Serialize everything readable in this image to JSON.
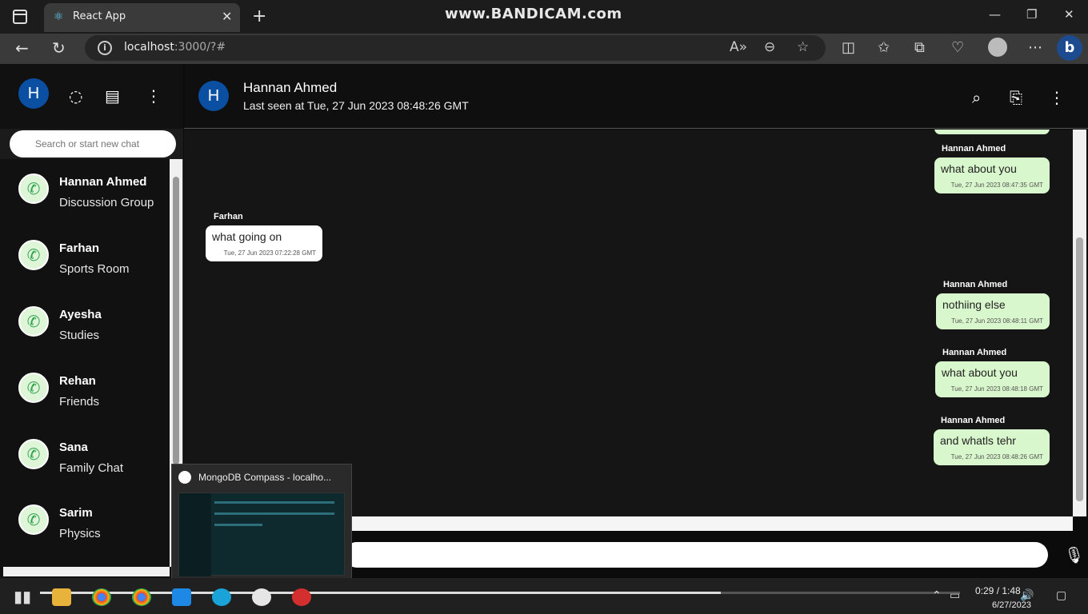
{
  "browser": {
    "tab_title": "React App",
    "url_host": "localhost",
    "url_path": ":3000/?#",
    "watermark": "www.BANDICAM.com"
  },
  "sidebar": {
    "user_initial": "H",
    "search_placeholder": "Search or start new chat",
    "chats": [
      {
        "name": "Hannan Ahmed",
        "subtitle": "Discussion Group"
      },
      {
        "name": "Farhan",
        "subtitle": "Sports Room"
      },
      {
        "name": "Ayesha",
        "subtitle": "Studies"
      },
      {
        "name": "Rehan",
        "subtitle": "Friends"
      },
      {
        "name": "Sana",
        "subtitle": "Family Chat"
      },
      {
        "name": "Sarim",
        "subtitle": "Physics"
      }
    ]
  },
  "chat": {
    "initial": "H",
    "name": "Hannan Ahmed",
    "last_seen": "Last seen at Tue, 27 Jun 2023 08:48:26 GMT",
    "messages": [
      {
        "author": "Hannan Ahmed",
        "text": "what about you",
        "time": "Tue, 27 Jun 2023 08:47:35 GMT",
        "direction": "out"
      },
      {
        "author": "Farhan",
        "text": "what going on",
        "time": "Tue, 27 Jun 2023 07:22:28 GMT",
        "direction": "in"
      },
      {
        "author": "Hannan Ahmed",
        "text": "nothiing else",
        "time": "Tue, 27 Jun 2023 08:48:11 GMT",
        "direction": "out"
      },
      {
        "author": "Hannan Ahmed",
        "text": "what about you",
        "time": "Tue, 27 Jun 2023 08:48:18 GMT",
        "direction": "out"
      },
      {
        "author": "Hannan Ahmed",
        "text": "and whatls tehr",
        "time": "Tue, 27 Jun 2023 08:48:26 GMT",
        "direction": "out"
      }
    ]
  },
  "taskbar": {
    "preview_title": "MongoDB Compass - localho...",
    "clock_time": "0:29 / 1:48",
    "clock_date": "6/27/2023",
    "playback_progress": 0.74
  },
  "colors": {
    "accent": "#0b4fa3",
    "outgoing_bubble": "#d9f7cc",
    "incoming_bubble": "#ffffff"
  }
}
